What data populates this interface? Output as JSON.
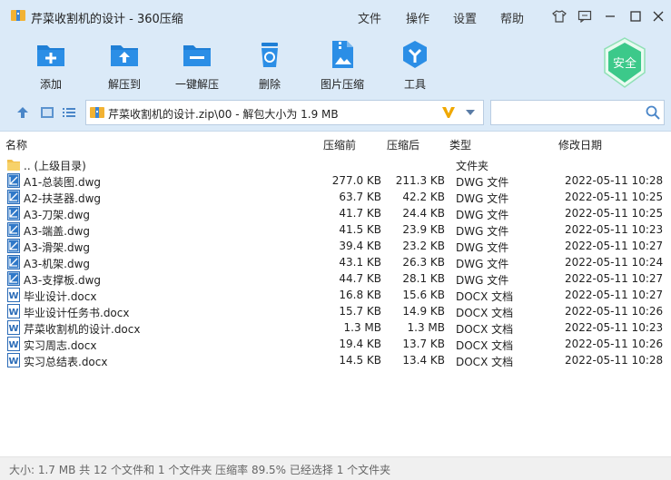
{
  "window": {
    "title": "芹菜收割机的设计 - 360压缩",
    "menu": [
      "文件",
      "操作",
      "设置",
      "帮助"
    ]
  },
  "toolbar": {
    "buttons": [
      {
        "label": "添加",
        "icon": "add-icon"
      },
      {
        "label": "解压到",
        "icon": "extract-to-icon"
      },
      {
        "label": "一键解压",
        "icon": "one-click-extract-icon"
      },
      {
        "label": "删除",
        "icon": "delete-icon"
      },
      {
        "label": "图片压缩",
        "icon": "image-compress-icon"
      },
      {
        "label": "工具",
        "icon": "tools-icon"
      }
    ],
    "safe_badge": "安全"
  },
  "address": {
    "path": "芹菜收割机的设计.zip\\00 - 解包大小为 1.9 MB",
    "search_value": ""
  },
  "columns": {
    "name": "名称",
    "original": "压缩前",
    "compressed": "压缩后",
    "type": "类型",
    "modified": "修改日期"
  },
  "files": [
    {
      "name": ".. (上级目录)",
      "original": "",
      "compressed": "",
      "type": "文件夹",
      "modified": "",
      "kind": "folder"
    },
    {
      "name": "A1-总装图.dwg",
      "original": "277.0 KB",
      "compressed": "211.3 KB",
      "type": "DWG 文件",
      "modified": "2022-05-11 10:28",
      "kind": "dwg"
    },
    {
      "name": "A2-扶茎器.dwg",
      "original": "63.7 KB",
      "compressed": "42.2 KB",
      "type": "DWG 文件",
      "modified": "2022-05-11 10:25",
      "kind": "dwg"
    },
    {
      "name": "A3-刀架.dwg",
      "original": "41.7 KB",
      "compressed": "24.4 KB",
      "type": "DWG 文件",
      "modified": "2022-05-11 10:25",
      "kind": "dwg"
    },
    {
      "name": "A3-端盖.dwg",
      "original": "41.5 KB",
      "compressed": "23.9 KB",
      "type": "DWG 文件",
      "modified": "2022-05-11 10:23",
      "kind": "dwg"
    },
    {
      "name": "A3-滑架.dwg",
      "original": "39.4 KB",
      "compressed": "23.2 KB",
      "type": "DWG 文件",
      "modified": "2022-05-11 10:27",
      "kind": "dwg"
    },
    {
      "name": "A3-机架.dwg",
      "original": "43.1 KB",
      "compressed": "26.3 KB",
      "type": "DWG 文件",
      "modified": "2022-05-11 10:24",
      "kind": "dwg"
    },
    {
      "name": "A3-支撑板.dwg",
      "original": "44.7 KB",
      "compressed": "28.1 KB",
      "type": "DWG 文件",
      "modified": "2022-05-11 10:27",
      "kind": "dwg"
    },
    {
      "name": "毕业设计.docx",
      "original": "16.8 KB",
      "compressed": "15.6 KB",
      "type": "DOCX 文档",
      "modified": "2022-05-11 10:27",
      "kind": "docx"
    },
    {
      "name": "毕业设计任务书.docx",
      "original": "15.7 KB",
      "compressed": "14.9 KB",
      "type": "DOCX 文档",
      "modified": "2022-05-11 10:26",
      "kind": "docx"
    },
    {
      "name": "芹菜收割机的设计.docx",
      "original": "1.3 MB",
      "compressed": "1.3 MB",
      "type": "DOCX 文档",
      "modified": "2022-05-11 10:23",
      "kind": "docx"
    },
    {
      "name": "实习周志.docx",
      "original": "19.4 KB",
      "compressed": "13.7 KB",
      "type": "DOCX 文档",
      "modified": "2022-05-11 10:26",
      "kind": "docx"
    },
    {
      "name": "实习总结表.docx",
      "original": "14.5 KB",
      "compressed": "13.4 KB",
      "type": "DOCX 文档",
      "modified": "2022-05-11 10:28",
      "kind": "docx"
    }
  ],
  "status": "大小: 1.7 MB 共 12 个文件和 1 个文件夹 压缩率 89.5% 已经选择 1 个文件夹",
  "colors": {
    "accent": "#1f7fd6",
    "toolbar_bg": "#dbeaf8",
    "safe_green": "#3cc98a"
  }
}
